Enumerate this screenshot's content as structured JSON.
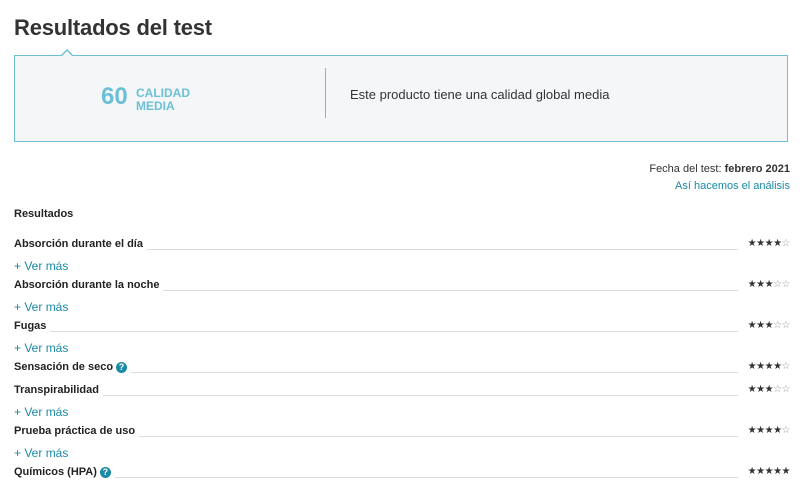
{
  "page_title": "Resultados del test",
  "score": {
    "value": "60",
    "label": "CALIDAD MEDIA",
    "summary": "Este producto tiene una calidad global media"
  },
  "test_info": {
    "date_label": "Fecha del test:",
    "date_value": "febrero 2021",
    "method_link": "Así hacemos el análisis"
  },
  "results": {
    "heading": "Resultados",
    "ver_mas_label": "+ Ver más",
    "items": [
      {
        "label": "Absorción durante el día",
        "stars": 4,
        "max_stars": 5,
        "has_help": false,
        "has_ver_mas": true
      },
      {
        "label": "Absorción durante la noche",
        "stars": 3,
        "max_stars": 5,
        "has_help": false,
        "has_ver_mas": true
      },
      {
        "label": "Fugas",
        "stars": 3,
        "max_stars": 5,
        "has_help": false,
        "has_ver_mas": true
      },
      {
        "label": "Sensación de seco",
        "stars": 4,
        "max_stars": 5,
        "has_help": true,
        "has_ver_mas": false
      },
      {
        "label": "Transpirabilidad",
        "stars": 3,
        "max_stars": 5,
        "has_help": false,
        "has_ver_mas": true
      },
      {
        "label": "Prueba práctica de uso",
        "stars": 4,
        "max_stars": 5,
        "has_help": false,
        "has_ver_mas": true
      },
      {
        "label": "Químicos (HPA)",
        "stars": 5,
        "max_stars": 5,
        "has_help": true,
        "has_ver_mas": false
      }
    ]
  },
  "colors": {
    "accent": "#6cc0d5",
    "link": "#1a8aa6",
    "box_bg": "#f5f6f8"
  }
}
